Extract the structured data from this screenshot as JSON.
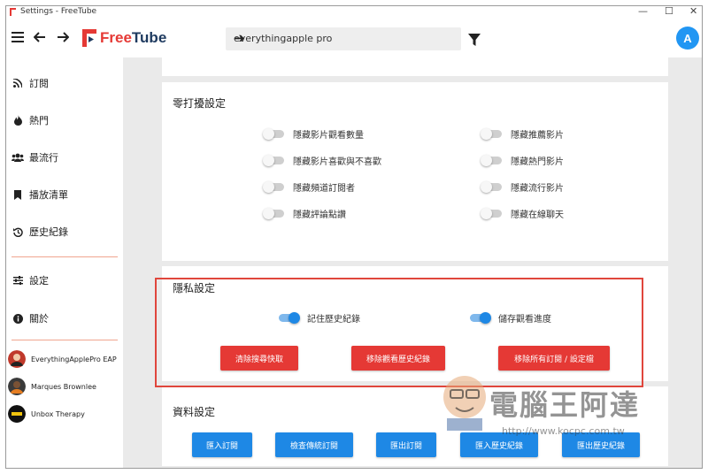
{
  "window": {
    "title": "Settings - FreeTube",
    "minimize": "—",
    "maximize": "☐",
    "close": "✕"
  },
  "topbar": {
    "app_name": "FreeTube",
    "search_value": "everythingapple pro",
    "avatar_letter": "A",
    "brand_color": "#e53935",
    "accent_color": "#2196f3"
  },
  "sidebar": {
    "items": [
      {
        "label": "訂閱",
        "icon": "rss-icon"
      },
      {
        "label": "熱門",
        "icon": "flame-icon"
      },
      {
        "label": "最流行",
        "icon": "users-icon"
      },
      {
        "label": "播放清單",
        "icon": "bookmark-icon"
      },
      {
        "label": "歷史紀錄",
        "icon": "history-icon"
      },
      {
        "label": "設定",
        "icon": "sliders-icon"
      },
      {
        "label": "關於",
        "icon": "info-icon"
      }
    ],
    "subscriptions": [
      {
        "name": "EverythingApplePro EAP"
      },
      {
        "name": "Marques Brownlee"
      },
      {
        "name": "Unbox Therapy"
      }
    ]
  },
  "distraction": {
    "title": "零打擾設定",
    "left": [
      "隱藏影片觀看數量",
      "隱藏影片喜歡與不喜歡",
      "隱藏頻道訂閱者",
      "隱藏評論點讚"
    ],
    "right": [
      "隱藏推薦影片",
      "隱藏熱門影片",
      "隱藏流行影片",
      "隱藏在線聊天"
    ]
  },
  "privacy": {
    "title": "隱私設定",
    "remember_history": "記住歷史紀錄",
    "save_progress": "儲存觀看進度",
    "clear_search_cache": "清除搜尋快取",
    "remove_watch_history": "移除觀看歷史紀錄",
    "remove_all_subs": "移除所有訂閱 / 設定檔"
  },
  "data_settings": {
    "title": "資料設定",
    "import_subs": "匯入訂閱",
    "check_legacy": "檢查傳統訂閱",
    "export_subs": "匯出訂閱",
    "import_history": "匯入歷史紀錄",
    "export_history": "匯出歷史紀錄"
  },
  "watermark": {
    "text": "電腦王阿達",
    "url": "http://www.kocpc.com.tw"
  }
}
